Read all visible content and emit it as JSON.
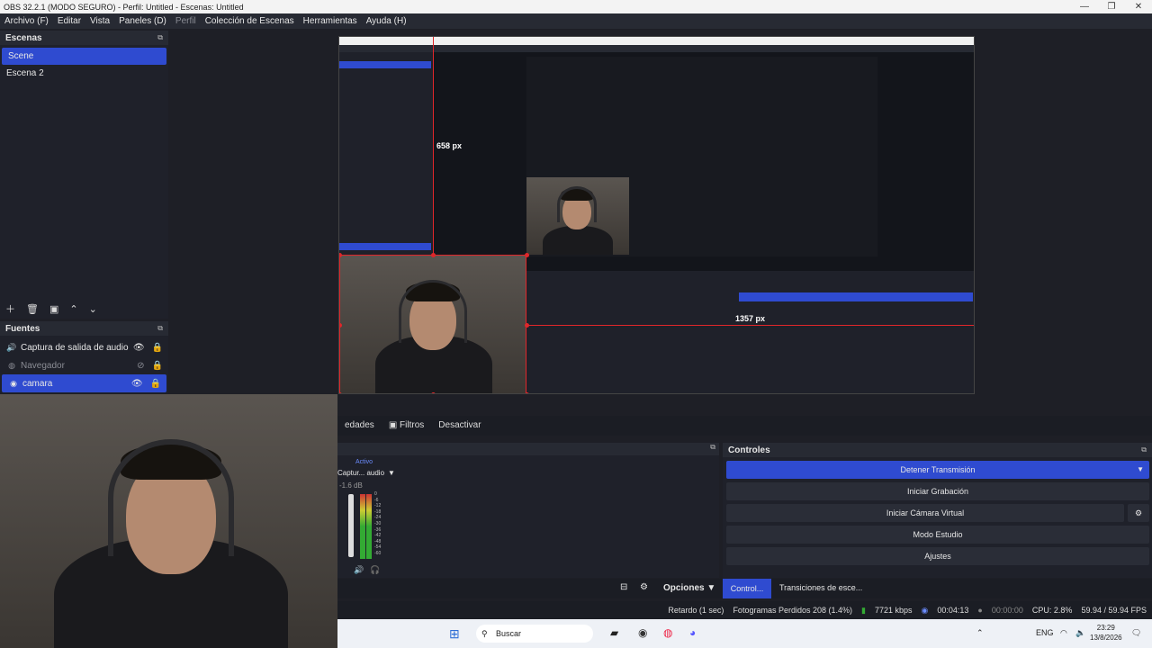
{
  "window": {
    "title": "OBS 32.2.1 (MODO SEGURO) - Perfil: Untitled - Escenas: Untitled",
    "controls": {
      "minimize": "—",
      "maximize": "❐",
      "close": "✕"
    }
  },
  "menu": [
    "Archivo (F)",
    "Editar",
    "Vista",
    "Paneles (D)",
    "Perfil",
    "Colección de Escenas",
    "Herramientas",
    "Ayuda (H)"
  ],
  "scenes": {
    "title": "Escenas",
    "items": [
      "Scene",
      "Escena 2"
    ],
    "selected": 0
  },
  "sources": {
    "title": "Fuentes",
    "items": [
      {
        "label": "Captura de salida de audio",
        "icon": "speaker-icon"
      },
      {
        "label": "Navegador",
        "icon": "globe-icon"
      },
      {
        "label": "camara",
        "icon": "camera-icon"
      }
    ]
  },
  "preview": {
    "height_label": "658 px",
    "width_label": "1357 px"
  },
  "source_toolbar": {
    "properties_partial": "edades",
    "filters": "Filtros",
    "deactivate": "Desactivar"
  },
  "mixer": {
    "active_label": "Activo",
    "channel": "Captur... audio",
    "db": "-1.6 dB",
    "scale": [
      "0",
      "-6",
      "-12",
      "-18",
      "-24",
      "-30",
      "-36",
      "-42",
      "-48",
      "-54",
      "-60"
    ]
  },
  "controls": {
    "title": "Controles",
    "stream": "Detener Transmisión",
    "record": "Iniciar Grabación",
    "virtualcam": "Iniciar Cámara Virtual",
    "studio": "Modo Estudio",
    "settings": "Ajustes"
  },
  "bottom_tabs": {
    "options": "Opciones",
    "controls_tab": "Control...",
    "transitions_tab": "Transiciones de esce..."
  },
  "status": {
    "delay": "Retardo (1 sec)",
    "dropped": "Fotogramas Perdidos 208 (1.4%)",
    "bitrate": "7721 kbps",
    "stream_time": "00:04:13",
    "rec_time": "00:00:00",
    "cpu": "CPU: 2.8%",
    "fps": "59.94 / 59.94 FPS"
  },
  "taskbar": {
    "search": "Buscar",
    "lang": "ENG",
    "time": "23:29",
    "date": "13/8/2026"
  }
}
